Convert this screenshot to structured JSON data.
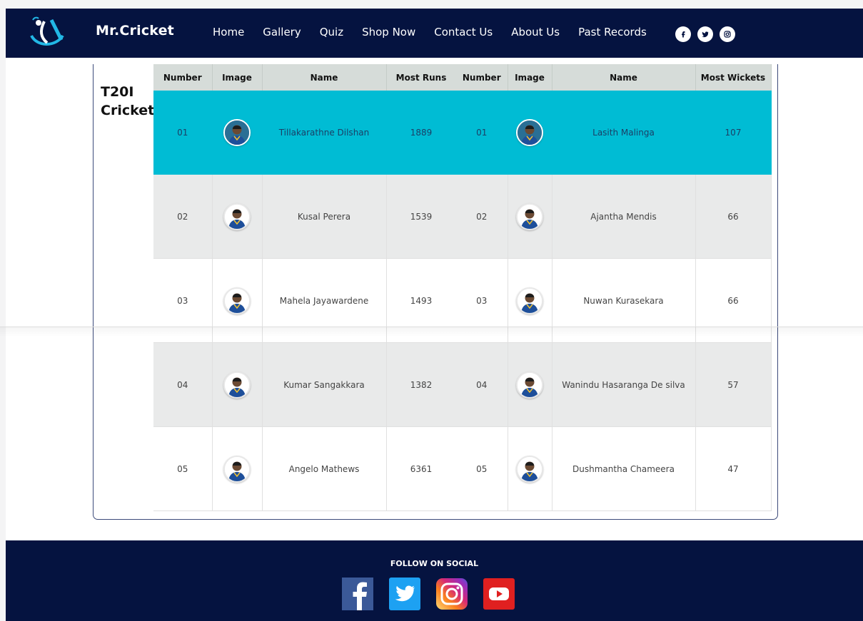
{
  "nav": {
    "brand": "Mr.Cricket",
    "links": [
      "Home",
      "Gallery",
      "Quiz",
      "Shop Now",
      "Contact Us",
      "About Us",
      "Past Records"
    ],
    "social_icons": [
      "facebook-icon",
      "twitter-icon",
      "instagram-icon"
    ]
  },
  "section": {
    "title": "T20I Cricket"
  },
  "runs_table": {
    "headers": [
      "Number",
      "Image",
      "Name",
      "Most Runs"
    ],
    "rows": [
      {
        "number": "01",
        "name": "Tillakarathne Dilshan",
        "value": "1889"
      },
      {
        "number": "02",
        "name": "Kusal Perera",
        "value": "1539"
      },
      {
        "number": "03",
        "name": "Mahela Jayawardene",
        "value": "1493"
      },
      {
        "number": "04",
        "name": "Kumar Sangakkara",
        "value": "1382"
      },
      {
        "number": "05",
        "name": "Angelo Mathews",
        "value": "6361"
      }
    ]
  },
  "wickets_table": {
    "headers": [
      "Number",
      "Image",
      "Name",
      "Most Wickets"
    ],
    "rows": [
      {
        "number": "01",
        "name": "Lasith Malinga",
        "value": "107"
      },
      {
        "number": "02",
        "name": "Ajantha Mendis",
        "value": "66"
      },
      {
        "number": "03",
        "name": "Nuwan Kurasekara",
        "value": "66"
      },
      {
        "number": "04",
        "name": "Wanindu Hasaranga De silva",
        "value": "57"
      },
      {
        "number": "05",
        "name": "Dushmantha Chameera",
        "value": "47"
      }
    ]
  },
  "footer": {
    "follow_label": "FOLLOW ON SOCIAL",
    "icons": [
      "facebook-icon",
      "twitter-icon",
      "instagram-icon",
      "youtube-icon"
    ]
  },
  "colors": {
    "navy": "#051340",
    "highlight_row": "#00bcd4",
    "header_row": "#d6dcd9",
    "alt_row": "#e9eaea"
  }
}
